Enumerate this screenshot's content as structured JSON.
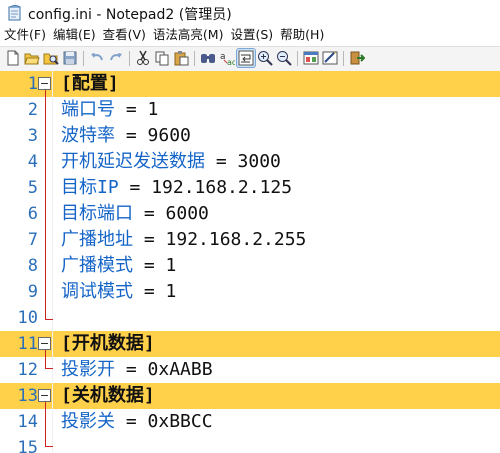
{
  "window": {
    "title": "config.ini - Notepad2 (管理员)",
    "app_icon": "notepad-icon"
  },
  "menu": [
    {
      "label": "文件(F)"
    },
    {
      "label": "编辑(E)"
    },
    {
      "label": "查看(V)"
    },
    {
      "label": "语法高亮(M)"
    },
    {
      "label": "设置(S)"
    },
    {
      "label": "帮助(H)"
    }
  ],
  "toolbar": {
    "buttons": [
      "new-icon",
      "open-icon",
      "browse-icon",
      "save-icon",
      "undo-icon",
      "redo-icon",
      "cut-icon",
      "copy-icon",
      "paste-icon",
      "find-icon",
      "replace-icon",
      "word-wrap-icon",
      "zoom-in-icon",
      "zoom-out-icon",
      "scheme-icon",
      "settings-icon",
      "exit-icon"
    ],
    "active": "word-wrap-icon"
  },
  "editor": {
    "lines": [
      {
        "num": "1",
        "type": "section",
        "text": "[配置]"
      },
      {
        "num": "2",
        "type": "kv",
        "key": "端口号",
        "eq": " = ",
        "value": "1"
      },
      {
        "num": "3",
        "type": "kv",
        "key": "波特率",
        "eq": " = ",
        "value": "9600"
      },
      {
        "num": "4",
        "type": "kv",
        "key": "开机延迟发送数据",
        "eq": " = ",
        "value": "3000"
      },
      {
        "num": "5",
        "type": "kv",
        "key": "目标IP",
        "eq": " = ",
        "value": "192.168.2.125"
      },
      {
        "num": "6",
        "type": "kv",
        "key": "目标端口",
        "eq": " = ",
        "value": "6000"
      },
      {
        "num": "7",
        "type": "kv",
        "key": "广播地址",
        "eq": " = ",
        "value": "192.168.2.255"
      },
      {
        "num": "8",
        "type": "kv",
        "key": "广播模式",
        "eq": " = ",
        "value": "1"
      },
      {
        "num": "9",
        "type": "kv",
        "key": "调试模式",
        "eq": " = ",
        "value": "1"
      },
      {
        "num": "10",
        "type": "empty"
      },
      {
        "num": "11",
        "type": "section",
        "text": "[开机数据]"
      },
      {
        "num": "12",
        "type": "kv",
        "key": "投影开",
        "eq": " = ",
        "value": "0xAABB"
      },
      {
        "num": "13",
        "type": "section",
        "text": "[关机数据]"
      },
      {
        "num": "14",
        "type": "kv",
        "key": "投影关",
        "eq": " = ",
        "value": "0xBBCC"
      },
      {
        "num": "15",
        "type": "empty"
      }
    ],
    "colors": {
      "section_highlight": "#ffd04a",
      "key": "#1565c8",
      "line_number": "#2a6fb8",
      "fold_marker": "#cc2222"
    }
  }
}
